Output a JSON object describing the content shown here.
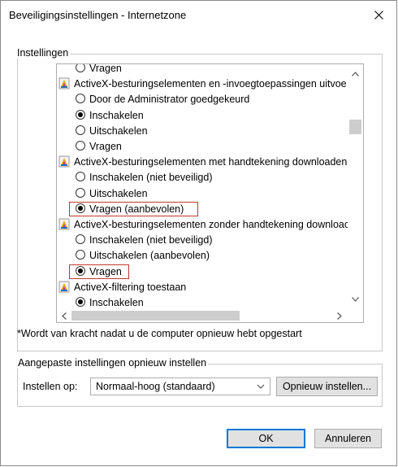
{
  "window": {
    "title": "Beveiligingsinstellingen - Internetzone",
    "close_icon": "close-icon"
  },
  "settings": {
    "legend": "Instellingen",
    "items": [
      {
        "kind": "radio",
        "label": "Vragen",
        "checked": false
      },
      {
        "kind": "group",
        "label": "ActiveX-besturingselementen en -invoegtoepassingen uitvoe"
      },
      {
        "kind": "radio",
        "label": "Door de Administrator goedgekeurd",
        "checked": false
      },
      {
        "kind": "radio",
        "label": "Inschakelen",
        "checked": true
      },
      {
        "kind": "radio",
        "label": "Uitschakelen",
        "checked": false
      },
      {
        "kind": "radio",
        "label": "Vragen",
        "checked": false
      },
      {
        "kind": "group",
        "label": "ActiveX-besturingselementen met handtekening downloaden"
      },
      {
        "kind": "radio",
        "label": "Inschakelen (niet beveiligd)",
        "checked": false
      },
      {
        "kind": "radio",
        "label": "Uitschakelen",
        "checked": false
      },
      {
        "kind": "radio",
        "label": "Vragen (aanbevolen)",
        "checked": true,
        "highlighted": true
      },
      {
        "kind": "group",
        "label": "ActiveX-besturingselementen zonder handtekening downloac"
      },
      {
        "kind": "radio",
        "label": "Inschakelen (niet beveiligd)",
        "checked": false
      },
      {
        "kind": "radio",
        "label": "Uitschakelen (aanbevolen)",
        "checked": false
      },
      {
        "kind": "radio",
        "label": "Vragen",
        "checked": true,
        "highlighted": true
      },
      {
        "kind": "group",
        "label": "ActiveX-filtering toestaan"
      },
      {
        "kind": "radio",
        "label": "Inschakelen",
        "checked": true
      }
    ],
    "footnote": "*Wordt van kracht nadat u de computer opnieuw hebt opgestart"
  },
  "reset": {
    "legend": "Aangepaste instellingen opnieuw instellen",
    "label": "Instellen op:",
    "selected": "Normaal-hoog (standaard)",
    "reset_button": "Opnieuw instellen..."
  },
  "footer": {
    "ok": "OK",
    "cancel": "Annuleren"
  },
  "colors": {
    "highlight_border": "#c0392b",
    "default_button_border": "#0078d7"
  }
}
